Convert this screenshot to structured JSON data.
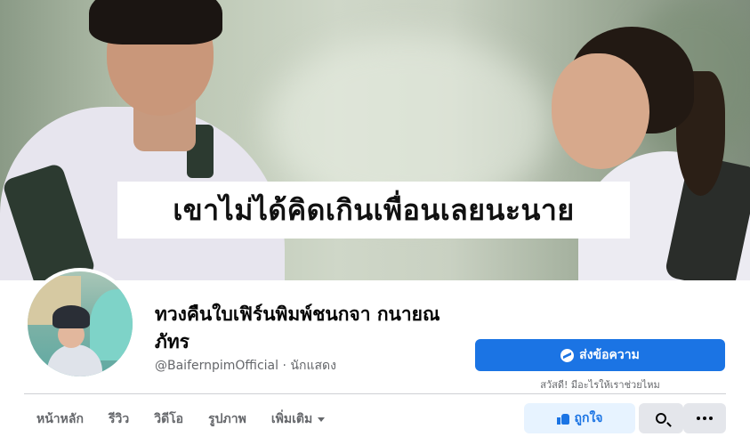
{
  "cover": {
    "caption": "เขาไม่ได้คิดเกินเพื่อนเลยนะนาย"
  },
  "profile": {
    "name": "ทวงคืนใบเฟิร์นพิมพ์ชนกจา กนายณภัทร",
    "handle": "@BaifernpimOfficial",
    "separator": "·",
    "category": "นักแสดง"
  },
  "actions": {
    "message_label": "ส่งข้อความ",
    "greeting": "สวัสดี! มีอะไรให้เราช่วยไหม",
    "like_label": "ถูกใจ"
  },
  "tabs": [
    {
      "label": "หน้าหลัก"
    },
    {
      "label": "รีวิว"
    },
    {
      "label": "วิดีโอ"
    },
    {
      "label": "รูปภาพ"
    },
    {
      "label": "เพิ่มเติม"
    }
  ],
  "icons": {
    "messenger": "messenger-icon",
    "like": "thumbs-up-icon",
    "search": "search-icon",
    "more": "more-dots-icon",
    "dropdown": "caret-down-icon"
  },
  "colors": {
    "primary": "#1b74e4",
    "like_bg": "#e7f3ff",
    "secondary_bg": "#e4e6eb",
    "muted_text": "#65676b"
  }
}
